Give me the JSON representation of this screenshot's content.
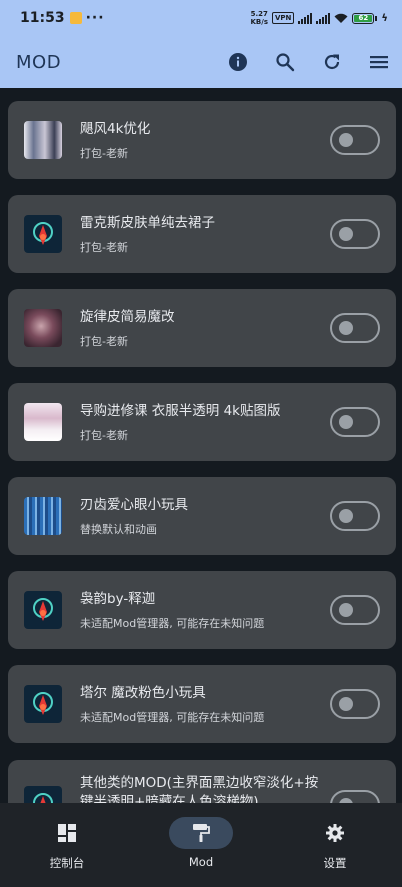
{
  "status_bar": {
    "time": "11:53",
    "net_speed_value": "5.27",
    "net_speed_unit": "KB/s",
    "vpn": "VPN",
    "signal_label": "HD",
    "battery": "62"
  },
  "app_bar": {
    "title": "MOD",
    "icons": [
      "info-icon",
      "search-icon",
      "refresh-icon",
      "menu-icon"
    ]
  },
  "mods": [
    {
      "name": "飓风4k优化",
      "desc": "打包-老新",
      "thumb": "image",
      "enabled": false
    },
    {
      "name": "雷克斯皮肤单纯去裙子",
      "desc": "打包-老新",
      "thumb": "app-icon",
      "enabled": false
    },
    {
      "name": "旋律皮简易魔改",
      "desc": "打包-老新",
      "thumb": "image",
      "enabled": false
    },
    {
      "name": "导购进修课 衣服半透明 4k贴图版",
      "desc": "打包-老新",
      "thumb": "image",
      "enabled": false
    },
    {
      "name": "刃齿爱心眼小玩具",
      "desc": "替换默认和动画",
      "thumb": "image",
      "enabled": false
    },
    {
      "name": "袅韵by-释迦",
      "desc": "未适配Mod管理器, 可能存在未知问题",
      "thumb": "app-icon",
      "enabled": false
    },
    {
      "name": "塔尔 魔改粉色小玩具",
      "desc": "未适配Mod管理器, 可能存在未知问题",
      "thumb": "app-icon",
      "enabled": false
    },
    {
      "name": "其他类的MOD(主界面黑边收窄淡化+按键半透明+暗藏在人色溶梯物)",
      "desc": "",
      "thumb": "app-icon",
      "enabled": false
    }
  ],
  "bottom_nav": [
    {
      "label": "控制台",
      "icon": "dashboard-icon",
      "active": false
    },
    {
      "label": "Mod",
      "icon": "paint-roller-icon",
      "active": true
    },
    {
      "label": "设置",
      "icon": "gear-icon",
      "active": false
    }
  ]
}
